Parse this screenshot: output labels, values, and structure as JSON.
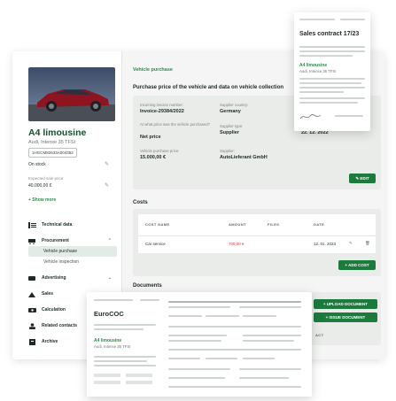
{
  "vehicle": {
    "title": "A4 limousine",
    "subtitle": "Audi, Intense 35 TFSI",
    "vin": "1HGCM82633A004352",
    "status": "On stock",
    "expected_price_label": "Expected sale price:",
    "expected_price": "40.000,00 €",
    "show_more": "+ Show more"
  },
  "menu": {
    "technical": "Technical data",
    "procurement": "Procurement",
    "vehicle_purchase": "Vehicle purchase",
    "vehicle_inspection": "Vehicle inspection",
    "advertising": "Advertising",
    "sales": "Sales",
    "calculation": "Calculation",
    "related": "Related contacts",
    "archive": "Archive"
  },
  "purchase": {
    "breadcrumb": "Vehicle purchase",
    "section_title": "Purchase price of the vehicle and data on vehicle collection",
    "invoice_label": "Incoming invoice number:",
    "invoice_value": "Invoice-29384/2022",
    "country_label": "Supplier country:",
    "country_value": "Germany",
    "collection_label": "Datum of collection:",
    "collection_value": "22. 12. 2022",
    "price_question_label": "At what price was the vehicle purchased?",
    "price_question_value": "Net price",
    "supplier_type_label": "Supplier type:",
    "supplier_type_value": "Supplier",
    "purchase_price_label": "Vehicle purchase price:",
    "purchase_price_value": "15.000,00 €",
    "supplier_label": "Supplier:",
    "supplier_value": "AutoLieferant GmbH",
    "edit_button": "✎ EDIT"
  },
  "costs": {
    "title": "Costs",
    "col_name": "COST NAME",
    "col_amount": "AMOUNT",
    "col_files": "FILES",
    "col_date": "DATE",
    "row_name": "Car service",
    "row_amount": "700,00 €",
    "row_date": "12. 01. 2023",
    "add_button": "+ ADD COST"
  },
  "documents": {
    "title": "Documents",
    "upload_button": "+ UPLOAD DOCUMENT",
    "issue_button": "+ ISSUE DOCUMENT",
    "partial_header": "ACT"
  },
  "sales_contract": {
    "title": "Sales contract 17/23",
    "car": "A4 limousine",
    "car_sub": "Audi, Intense 35 TFSI"
  },
  "eurococ": {
    "title": "EuroCOC",
    "car": "A4 limousine",
    "car_sub": "Audi, Intense 35 TFSI"
  },
  "colors": {
    "brand_green": "#1c7a3d",
    "link_green": "#2f8a4b",
    "title_green": "#184f2e",
    "amount_red": "#d9363e"
  }
}
